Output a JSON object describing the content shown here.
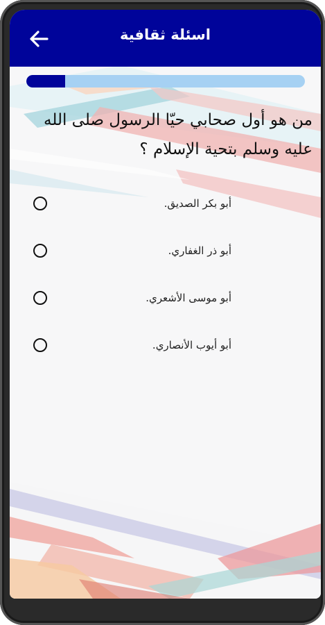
{
  "app": {
    "title": "اسئلة ثقافية",
    "back_icon": "arrow-left-icon",
    "accent_color": "#00049a",
    "progress_track_color": "#a6d1f3"
  },
  "quiz": {
    "progress_fraction": 0.14,
    "question": "من هو أول صحابي حيّا الرسول صلى الله عليه وسلم بتحية الإسلام ؟",
    "options": [
      {
        "label": "أبو بكر الصديق.",
        "selected": false
      },
      {
        "label": "أبو ذر الغفاري.",
        "selected": false
      },
      {
        "label": "أبو موسى الأشعري.",
        "selected": false
      },
      {
        "label": "أبو أيوب الأنصاري.",
        "selected": false
      }
    ]
  }
}
